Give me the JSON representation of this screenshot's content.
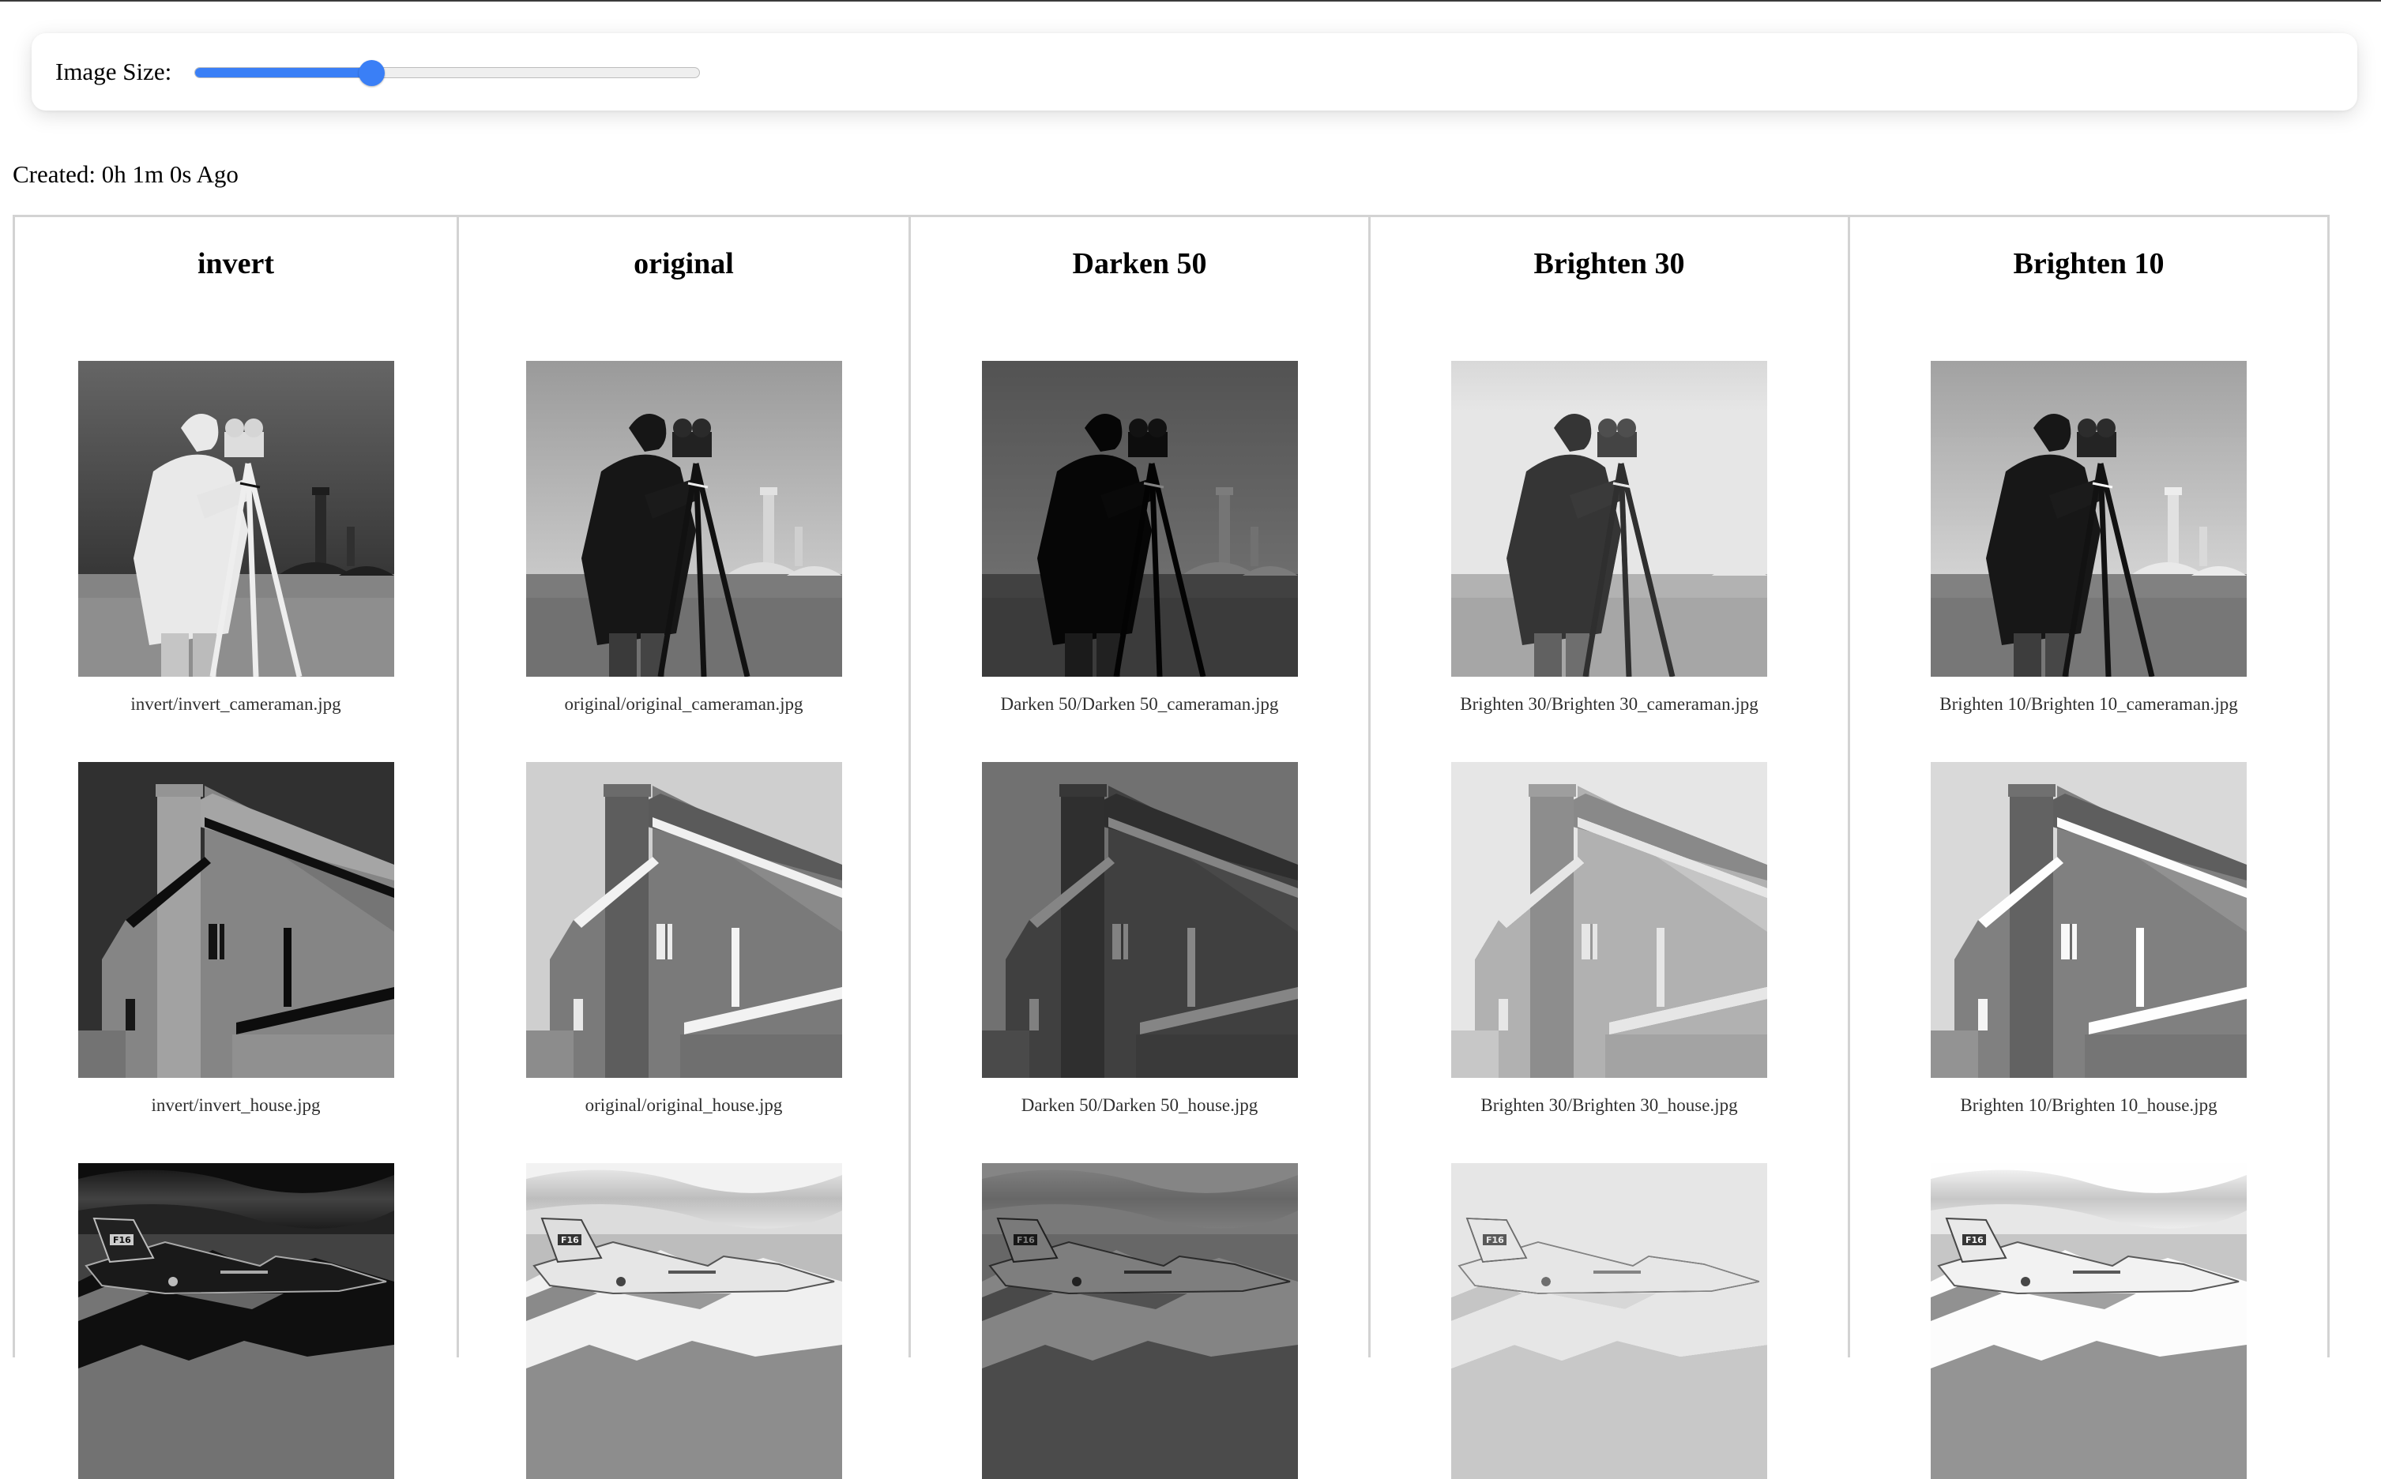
{
  "controls": {
    "image_size_label": "Image Size:",
    "image_size_value": 0.35
  },
  "created_text": "Created: 0h 1m 0s Ago",
  "colors": {
    "slider_accent": "#3a7ff6",
    "cell_border": "#d3d3d3",
    "caption_text": "#303030"
  },
  "columns": [
    {
      "title": "invert",
      "filter": "invert",
      "images": [
        {
          "subject": "cameraman",
          "caption": "invert/invert_cameraman.jpg"
        },
        {
          "subject": "house",
          "caption": "invert/invert_house.jpg"
        },
        {
          "subject": "jet",
          "caption": ""
        }
      ]
    },
    {
      "title": "original",
      "filter": "original",
      "images": [
        {
          "subject": "cameraman",
          "caption": "original/original_cameraman.jpg"
        },
        {
          "subject": "house",
          "caption": "original/original_house.jpg"
        },
        {
          "subject": "jet",
          "caption": ""
        }
      ]
    },
    {
      "title": "Darken 50",
      "filter": "darken",
      "images": [
        {
          "subject": "cameraman",
          "caption": "Darken 50/Darken 50_cameraman.jpg"
        },
        {
          "subject": "house",
          "caption": "Darken 50/Darken 50_house.jpg"
        },
        {
          "subject": "jet",
          "caption": ""
        }
      ]
    },
    {
      "title": "Brighten 30",
      "filter": "brighten-strong",
      "images": [
        {
          "subject": "cameraman",
          "caption": "Brighten 30/Brighten 30_cameraman.jpg"
        },
        {
          "subject": "house",
          "caption": "Brighten 30/Brighten 30_house.jpg"
        },
        {
          "subject": "jet",
          "caption": ""
        }
      ]
    },
    {
      "title": "Brighten 10",
      "filter": "brighten-light",
      "images": [
        {
          "subject": "cameraman",
          "caption": "Brighten 10/Brighten 10_cameraman.jpg"
        },
        {
          "subject": "house",
          "caption": "Brighten 10/Brighten 10_house.jpg"
        },
        {
          "subject": "jet",
          "caption": ""
        }
      ]
    }
  ]
}
